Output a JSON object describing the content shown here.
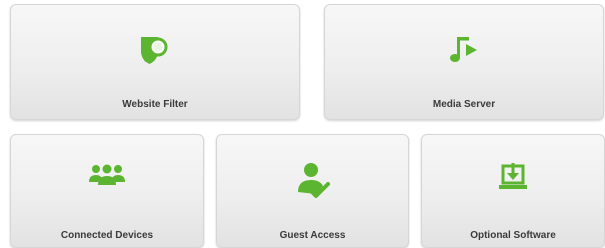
{
  "tiles": [
    {
      "label": "Website Filter",
      "icon": "website-filter-icon"
    },
    {
      "label": "Media Server",
      "icon": "media-server-icon"
    },
    {
      "label": "Connected Devices",
      "icon": "connected-devices-icon"
    },
    {
      "label": "Guest Access",
      "icon": "guest-access-icon"
    },
    {
      "label": "Optional Software",
      "icon": "optional-software-icon"
    }
  ],
  "colors": {
    "accent": "#5cb531",
    "label_text": "#3a3a3a",
    "tile_border": "#d6d6d6"
  }
}
